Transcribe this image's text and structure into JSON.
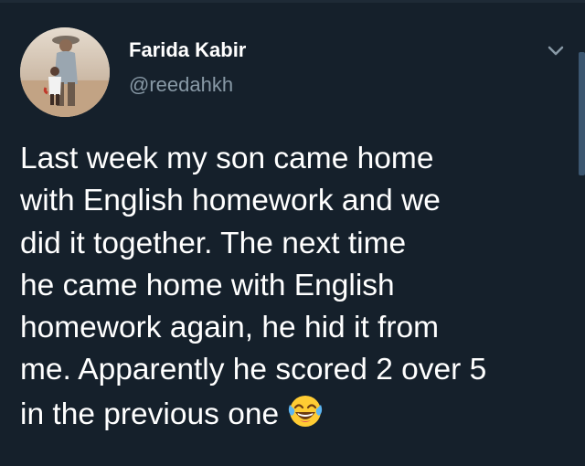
{
  "tweet": {
    "author": {
      "display_name": "Farida Kabir",
      "handle": "@reedahkh",
      "avatar_icon": "profile-photo"
    },
    "menu_icon": "chevron-down-icon",
    "text_lines": [
      "Last week my son came home",
      "with English homework and we",
      "did it together. The next time",
      "he came home with English",
      "homework again, he hid it from",
      "me. Apparently he scored 2 over 5",
      "in the previous one"
    ],
    "emoji": "face-with-tears-of-joy"
  },
  "colors": {
    "background": "#15202b",
    "text_primary": "#ffffff",
    "text_secondary": "#8899a6",
    "scrollbar": "#3b5670",
    "emoji_yellow": "#ffcc33"
  }
}
